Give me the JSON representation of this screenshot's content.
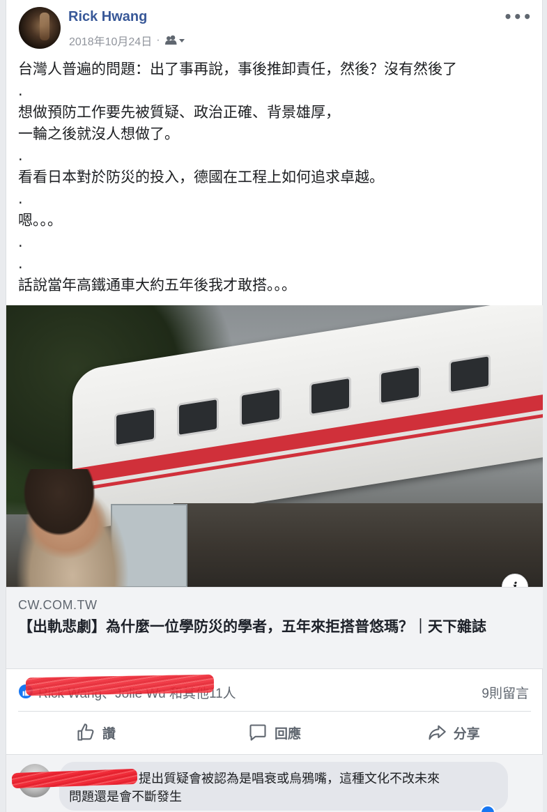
{
  "post": {
    "author": "Rick Hwang",
    "date": "2018年10月24日",
    "separator": "·",
    "privacy_icon": "friends-icon",
    "more_icon": "more-options-icon",
    "lines": [
      "台灣人普遍的問題：出了事再說，事後推卸責任，然後？沒有然後了",
      ".",
      "想做預防工作要先被質疑、政治正確、背景雄厚，",
      "一輪之後就沒人想做了。",
      ".",
      "看看日本對於防災的投入，德國在工程上如何追求卓越。",
      ".",
      "嗯。。。",
      ".",
      ".",
      "話說當年高鐵通車大約五年後我才敢搭。。。"
    ]
  },
  "link": {
    "domain": "CW.COM.TW",
    "title": "【出軌悲劇】為什麼一位學防災的學者，五年來拒搭普悠瑪？｜天下雜誌",
    "info_label": "i"
  },
  "reactions": {
    "names": "Rick Wang、Jolie Wu 和其他11人",
    "comments": "9則留言"
  },
  "actions": {
    "like": "讚",
    "comment": "回應",
    "share": "分享"
  },
  "comment": {
    "line1": "提出質疑會被認為是唱衰或烏鴉嘴，這種文化不改未來",
    "line2": "問題還是會不斷發生"
  },
  "colors": {
    "author": "#385898",
    "like_blue": "#1877f2",
    "redaction": "#ef2b38"
  }
}
